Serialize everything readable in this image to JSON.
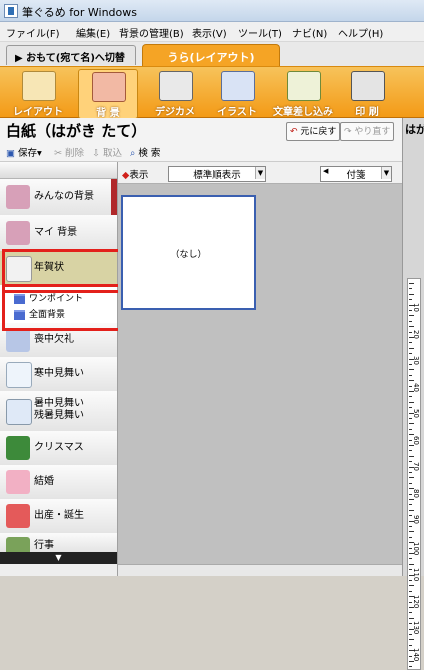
{
  "window": {
    "title": "筆ぐるめ for Windows"
  },
  "menu": [
    "ファイル(F)",
    "編集(E)",
    "背景の管理(B)",
    "表示(V)",
    "ツール(T)",
    "ナビ(N)",
    "ヘルプ(H)"
  ],
  "tabs": {
    "front": "▶ おもて(宛て名)へ切替",
    "back": "うら(レイアウト)"
  },
  "toolbar": [
    {
      "label": "レイアウト",
      "icon": "layout-icon",
      "color": "#f7e6b5"
    },
    {
      "label": "背 景",
      "icon": "background-icon",
      "color": "#f2b9a4"
    },
    {
      "label": "デジカメ",
      "icon": "camera-icon",
      "color": "#e9e9e9"
    },
    {
      "label": "イラスト",
      "icon": "illustration-icon",
      "color": "#d9e3f5"
    },
    {
      "label": "文章差し込み",
      "icon": "text-insert-icon",
      "color": "#eef2d8"
    },
    {
      "label": "印 刷",
      "icon": "printer-icon",
      "color": "#e4e4e4"
    }
  ],
  "heading": {
    "title": "白紙（はがき たて）",
    "undo": "元に戻す",
    "redo": "やり直す"
  },
  "right_panel": {
    "label": "はが"
  },
  "actions": {
    "save": "保存",
    "delete": "削除",
    "import": "取込",
    "search": "検 索"
  },
  "filter": {
    "show_label": "表示",
    "sort": "標準順表示",
    "tag": "付箋"
  },
  "sidebar": {
    "categories": [
      {
        "label": "みんなの背景",
        "icon": "people-icon"
      },
      {
        "label": "マイ 背景",
        "icon": "my-background-icon"
      },
      {
        "label": "年賀状",
        "icon": "new-year-card-icon"
      },
      {
        "label": "喪中欠礼",
        "icon": "mourning-icon"
      },
      {
        "label": "寒中見舞い",
        "icon": "snowman-icon"
      },
      {
        "label": "暑中見舞い",
        "label2": "残暑見舞い",
        "icon": "summer-card-icon"
      },
      {
        "label": "クリスマス",
        "icon": "christmas-tree-icon"
      },
      {
        "label": "結婚",
        "icon": "wedding-icon"
      },
      {
        "label": "出産・誕生",
        "icon": "birth-icon"
      },
      {
        "label": "行事",
        "icon": "event-icon"
      }
    ],
    "subitems": [
      "ワンポイント",
      "全面背景"
    ]
  },
  "card": {
    "label": "（なし）"
  },
  "ruler_numbers": [
    "10",
    "20",
    "30",
    "40",
    "50",
    "60",
    "70",
    "80",
    "90",
    "100",
    "110",
    "120",
    "130",
    "140"
  ]
}
